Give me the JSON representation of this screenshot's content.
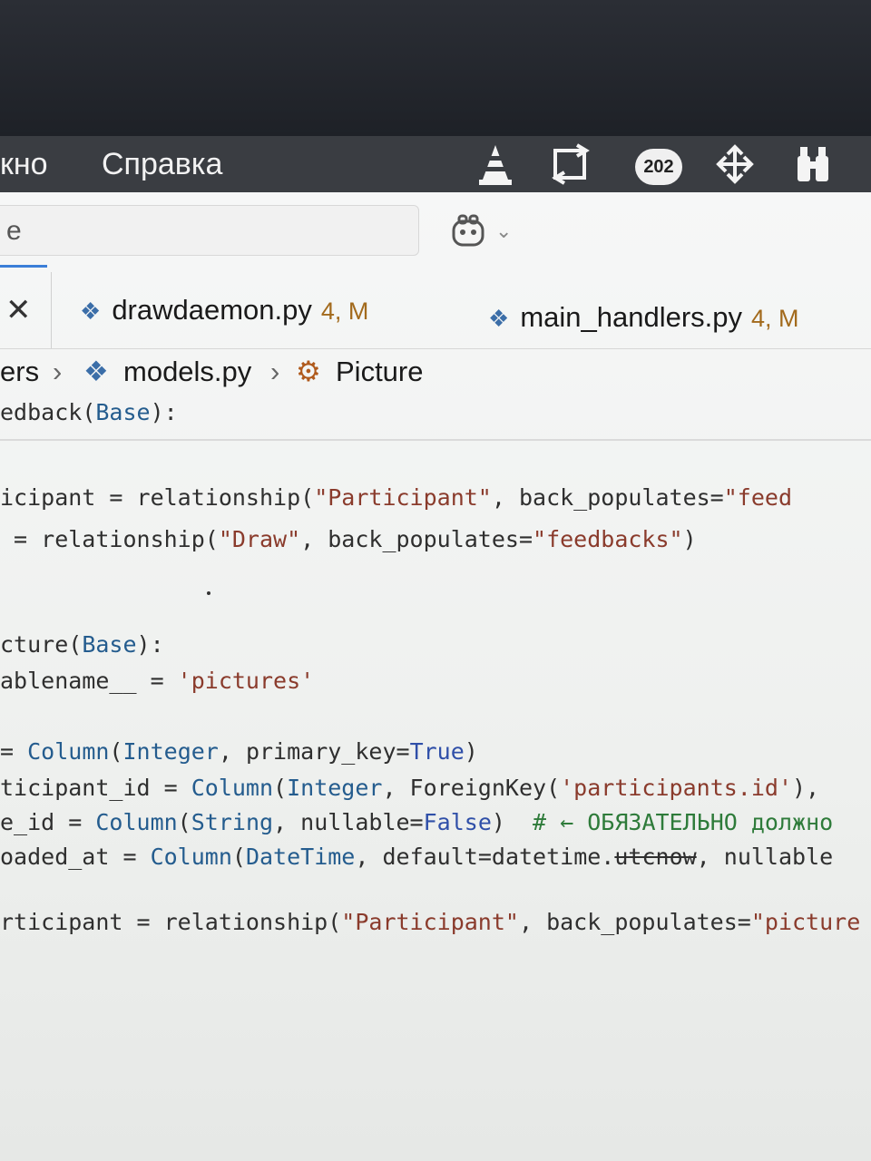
{
  "menubar": {
    "items": [
      "кно",
      "Справка"
    ],
    "status_icons": [
      "vlc-cone-icon",
      "sync-icon",
      "move-icon",
      "binoculars-icon"
    ],
    "badge_count": "202"
  },
  "search": {
    "text": "e"
  },
  "tabs": [
    {
      "label": "drawdaemon.py",
      "status": "4, M"
    },
    {
      "label": "main_handlers.py",
      "status": "4, M"
    }
  ],
  "breadcrumbs": {
    "folder": "ers",
    "file": "models.py",
    "symbol": "Picture"
  },
  "code": {
    "sticky": [
      "edback",
      "(",
      "Base",
      ")",
      ":"
    ],
    "l1": [
      "icipant = relationship(",
      "\"Participant\"",
      ", back_populates=",
      "\"feed"
    ],
    "l2": [
      " = relationship(",
      "\"Draw\"",
      ", back_populates=",
      "\"feedbacks\"",
      ")"
    ],
    "l3": [
      "cture(",
      "Base",
      "):"
    ],
    "l4": [
      "ablename__ = ",
      "'pictures'"
    ],
    "l5": [
      "= ",
      "Column",
      "(",
      "Integer",
      ", primary_key=",
      "True",
      ")"
    ],
    "l6": [
      "ticipant_id = ",
      "Column",
      "(",
      "Integer",
      ", ForeignKey(",
      "'participants.id'",
      "),"
    ],
    "l7": [
      "e_id = ",
      "Column",
      "(",
      "String",
      ", nullable=",
      "False",
      ")  ",
      "# ← ОБЯЗАТЕЛЬНО должно"
    ],
    "l8": [
      "oaded_at = ",
      "Column",
      "(",
      "DateTime",
      ", default=datetime.",
      "utcnow",
      ", nullable"
    ],
    "l9": [
      "rticipant = relationship(",
      "\"Participant\"",
      ", back_populates=",
      "\"picture"
    ]
  }
}
